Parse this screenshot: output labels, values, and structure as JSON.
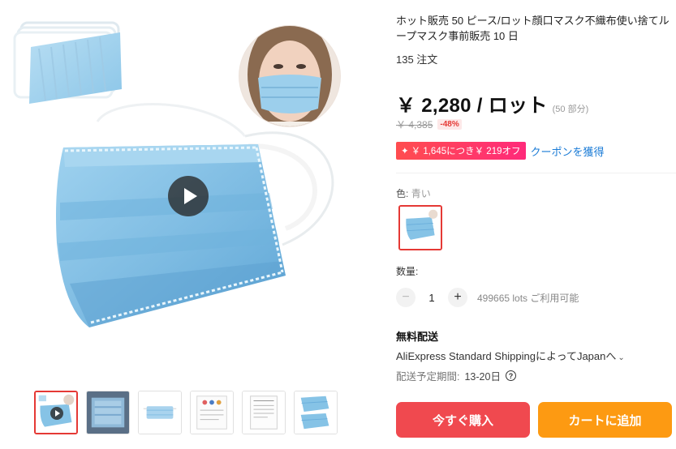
{
  "product": {
    "title": "ホット販売 50 ピース/ロット顔口マスク不織布使い捨てループマスク事前販売 10 日",
    "orders": "135 注文"
  },
  "pricing": {
    "price": "￥ 2,280 / ロット",
    "unit_note": "(50 部分)",
    "original_price": "￥ 4,385",
    "discount": "-48%",
    "coupon_badge": "￥ 1,645につき￥ 219オフ",
    "coupon_icon": "sparkle-icon",
    "coupon_link": "クーポンを獲得"
  },
  "options": {
    "color_label": "色:",
    "color_value": "青い"
  },
  "quantity": {
    "label": "数量:",
    "minus": "−",
    "plus": "+",
    "value": "1",
    "stock": "499665 lots ご利用可能"
  },
  "shipping": {
    "title": "無料配送",
    "method": "AliExpress Standard ShippingによってJapanへ",
    "chevron": "⌄",
    "delivery_label": "配送予定期間:",
    "delivery_dates": "13-20日",
    "help_icon": "?"
  },
  "actions": {
    "buy_now": "今すぐ購入",
    "add_to_cart": "カートに追加"
  },
  "gallery": {
    "thumbnails": [
      "mask-video",
      "mask-package",
      "mask-single",
      "certificate-1",
      "certificate-2",
      "mask-pair"
    ]
  },
  "colors": {
    "accent_red": "#f0494f",
    "accent_orange": "#fd9a12",
    "link_blue": "#1a7bd6",
    "mask_blue": "#86c3e6"
  }
}
